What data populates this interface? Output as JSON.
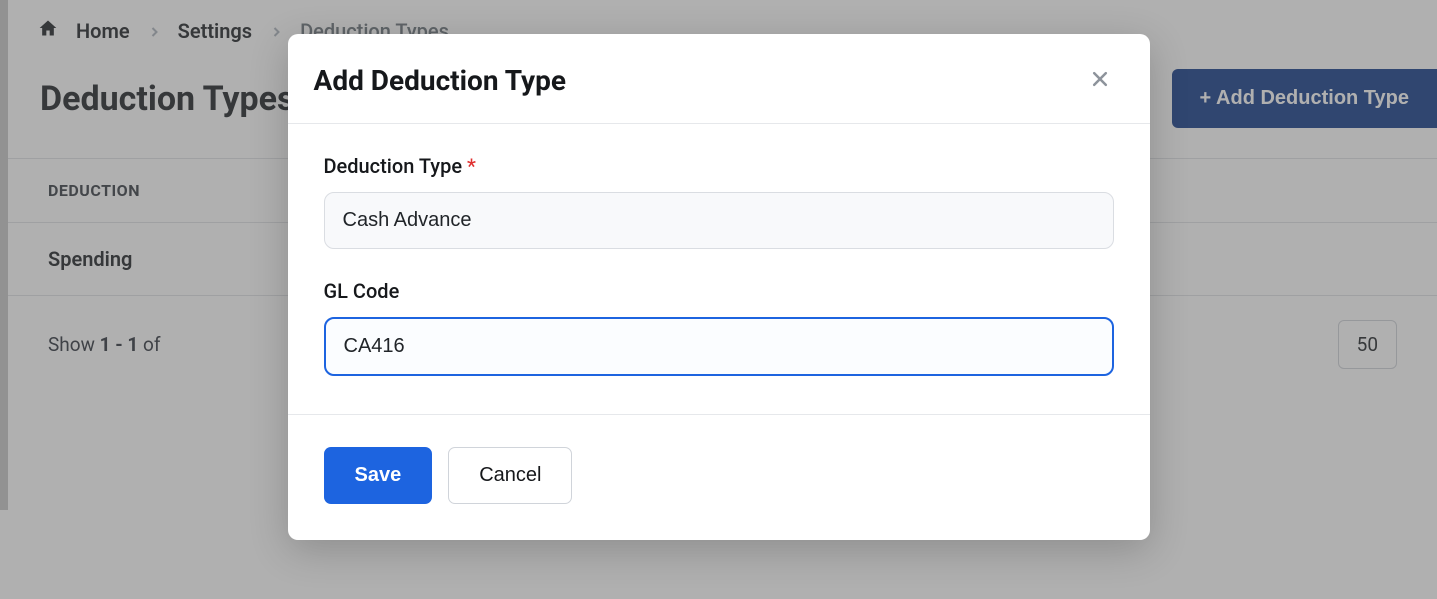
{
  "breadcrumb": {
    "home_label": "Home",
    "settings_label": "Settings",
    "current_label": "Deduction Types"
  },
  "page": {
    "title": "Deduction Types",
    "add_button_label": "+ Add Deduction Type"
  },
  "table": {
    "header_deduction": "Deduction",
    "rows": [
      {
        "name": "Spending"
      }
    ]
  },
  "pager": {
    "prefix": "Show ",
    "range": "1 - 1",
    "suffix": " of",
    "page_size": "50"
  },
  "modal": {
    "title": "Add Deduction Type",
    "fields": {
      "deduction_type": {
        "label": "Deduction Type",
        "required_mark": "*",
        "value": "Cash Advance"
      },
      "gl_code": {
        "label": "GL Code",
        "value": "CA416"
      }
    },
    "save_label": "Save",
    "cancel_label": "Cancel"
  }
}
